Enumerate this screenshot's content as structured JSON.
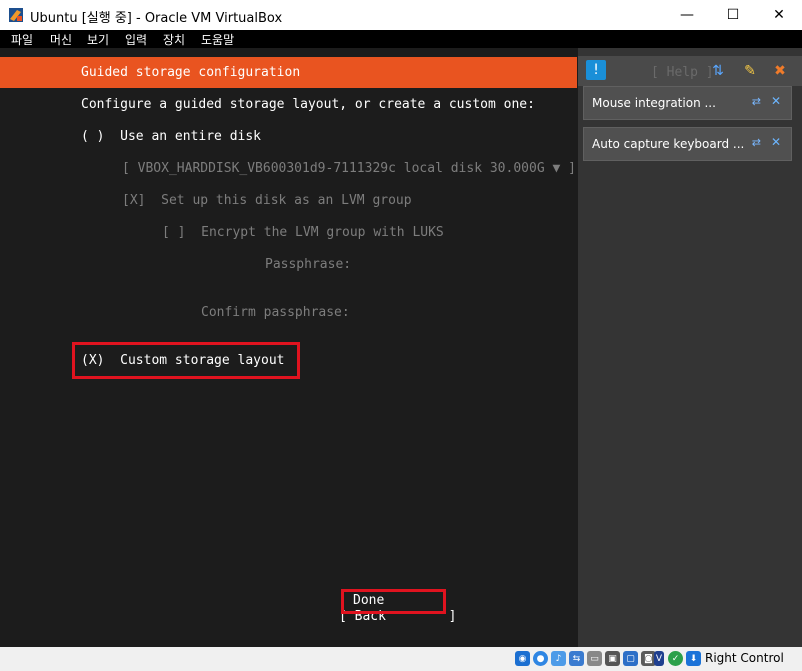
{
  "window": {
    "title": "Ubuntu [실행 중] - Oracle VM VirtualBox",
    "minimize": "—",
    "maximize": "☐",
    "close": "✕"
  },
  "menu": [
    "파일",
    "머신",
    "보기",
    "입력",
    "장치",
    "도움말"
  ],
  "installer": {
    "header_title": "Guided storage configuration",
    "header_help": "[ Help ]",
    "intro": "Configure a guided storage layout, or create a custom one:",
    "entire_disk": "( )  Use an entire disk",
    "disk_select": "[ VBOX_HARDDISK_VB600301d9-7111329c local disk 30.000G ▼ ]",
    "lvm": "[X]  Set up this disk as an LVM group",
    "encrypt": "[ ]  Encrypt the LVM group with LUKS",
    "passphrase_label": "Passphrase:",
    "confirm_label": "Confirm passphrase:",
    "custom_layout": "(X)  Custom storage layout",
    "done_button": "Done",
    "back_button": "[ Back        ]"
  },
  "notifications": [
    {
      "text": "Mouse integration ..."
    },
    {
      "text": "Auto capture keyboard ..."
    }
  ],
  "status": {
    "host_key": "Right Control"
  },
  "colors": {
    "accent": "#e95420",
    "highlight_box": "#e0131f"
  }
}
